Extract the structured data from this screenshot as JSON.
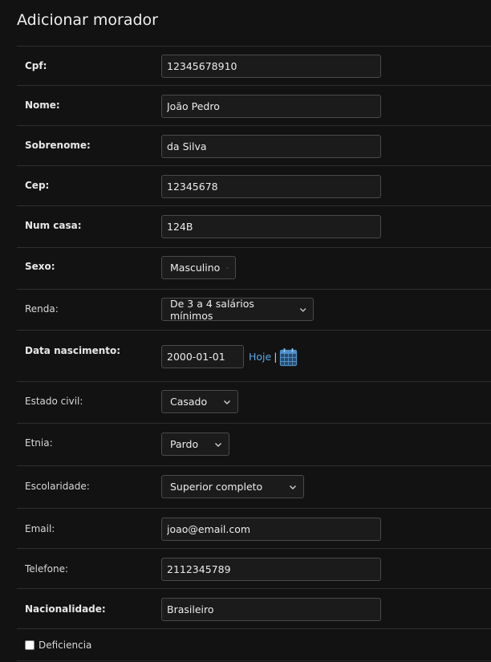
{
  "title": "Adicionar morador",
  "fields": {
    "cpf": {
      "label": "Cpf:",
      "value": "12345678910"
    },
    "nome": {
      "label": "Nome:",
      "value": "João Pedro"
    },
    "sobrenome": {
      "label": "Sobrenome:",
      "value": "da Silva"
    },
    "cep": {
      "label": "Cep:",
      "value": "12345678"
    },
    "num_casa": {
      "label": "Num casa:",
      "value": "124B"
    },
    "sexo": {
      "label": "Sexo:",
      "value": "Masculino"
    },
    "renda": {
      "label": "Renda:",
      "value": "De 3 a 4 salários mínimos"
    },
    "data_nascimento": {
      "label": "Data nascimento:",
      "value": "2000-01-01",
      "today_label": "Hoje",
      "separator": "|"
    },
    "estado_civil": {
      "label": "Estado civil:",
      "value": "Casado"
    },
    "etnia": {
      "label": "Etnia:",
      "value": "Pardo"
    },
    "escolaridade": {
      "label": "Escolaridade:",
      "value": "Superior completo"
    },
    "email": {
      "label": "Email:",
      "value": "joao@email.com"
    },
    "telefone": {
      "label": "Telefone:",
      "value": "2112345789"
    },
    "nacionalidade": {
      "label": "Nacionalidade:",
      "value": "Brasileiro"
    },
    "deficiencia": {
      "label": "Deficiencia",
      "checked": false
    }
  },
  "colors": {
    "background": "#121212",
    "link": "#5aa7e8",
    "calendar_icon": "#4f8fc9"
  },
  "icons": {
    "calendar": "calendar-icon",
    "dropdown": "chevron-down-icon"
  }
}
